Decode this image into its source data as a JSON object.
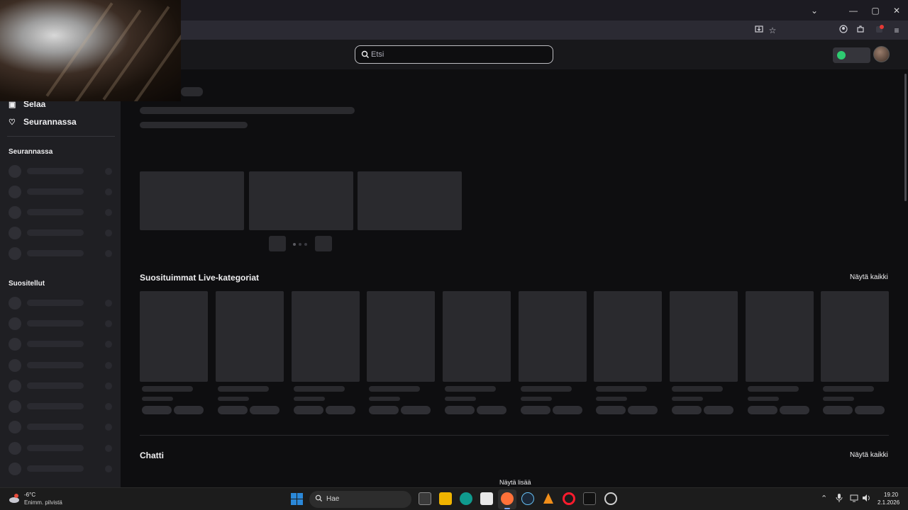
{
  "browser": {
    "tab_controls": {
      "minimize": "—",
      "maximize": "▢",
      "close": "✕",
      "list_tabs": "⌄"
    },
    "toolbar_icons": [
      "install-app-icon",
      "bookmark-star-icon",
      "account-icon",
      "extensions-icon",
      "extension-badge-icon",
      "menu-icon"
    ]
  },
  "topnav": {
    "search_placeholder": "Etsi"
  },
  "sidebar": {
    "nav": [
      {
        "label": "Selaa",
        "icon": "browse-icon"
      },
      {
        "label": "Seurannassa",
        "icon": "heart-icon"
      }
    ],
    "following_title": "Seurannassa",
    "recommended_title": "Suositellut"
  },
  "main": {
    "top_categories_title": "Suosituimmat Live-kategoriat",
    "top_categories_show_all": "Näytä kaikki",
    "chat_title": "Chatti",
    "chat_show_all": "Näytä kaikki",
    "show_more": "Näytä lisää"
  },
  "taskbar": {
    "weather_temp": "-6°C",
    "weather_desc": "Enimm. pilvistä",
    "search_label": "Hae",
    "time": "19.20",
    "date": "2.1.2026",
    "colors": {
      "windows_blue": "#2b88d8",
      "firefox_orange": "#ff7139",
      "opera_red": "#ff1b2d",
      "vlc_orange": "#f18e1a"
    }
  }
}
